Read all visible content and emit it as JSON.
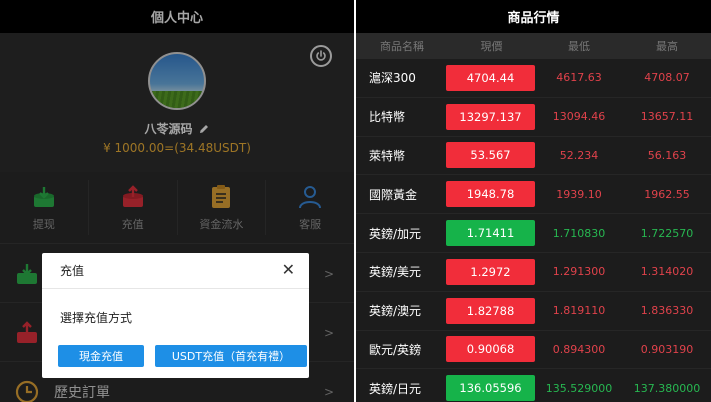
{
  "left": {
    "header_title": "個人中心",
    "username": "八苓源码",
    "balance": "¥ 1000.00=(34.48USDT)",
    "actions": [
      {
        "label": "提现",
        "icon": "download-box-icon",
        "color": "#2fb84f"
      },
      {
        "label": "充值",
        "icon": "upload-box-icon",
        "color": "#e8333f"
      },
      {
        "label": "資金流水",
        "icon": "clipboard-icon",
        "color": "#e8a93a"
      },
      {
        "label": "客服",
        "icon": "user-icon",
        "color": "#3b8ce0"
      }
    ],
    "list_rows": [
      {
        "label": "",
        "icon": "green-box-icon"
      },
      {
        "label": "",
        "icon": "red-box-icon"
      },
      {
        "label": "歷史訂單",
        "icon": "clock-icon"
      }
    ],
    "dialog": {
      "title": "充值",
      "prompt": "選擇充值方式",
      "btn_cash": "現金充值",
      "btn_usdt": "USDT充值（首充有禮）"
    }
  },
  "right": {
    "header_title": "商品行情",
    "columns": [
      "商品名稱",
      "現價",
      "最低",
      "最高"
    ],
    "rows": [
      {
        "name": "滬深300",
        "price": "4704.44",
        "low": "4617.63",
        "high": "4708.07",
        "trend": "red"
      },
      {
        "name": "比特幣",
        "price": "13297.137",
        "low": "13094.46",
        "high": "13657.11",
        "trend": "red"
      },
      {
        "name": "萊特幣",
        "price": "53.567",
        "low": "52.234",
        "high": "56.163",
        "trend": "red"
      },
      {
        "name": "國際黃金",
        "price": "1948.78",
        "low": "1939.10",
        "high": "1962.55",
        "trend": "red"
      },
      {
        "name": "英鎊/加元",
        "price": "1.71411",
        "low": "1.710830",
        "high": "1.722570",
        "trend": "green"
      },
      {
        "name": "英鎊/美元",
        "price": "1.2972",
        "low": "1.291300",
        "high": "1.314020",
        "trend": "red"
      },
      {
        "name": "英鎊/澳元",
        "price": "1.82788",
        "low": "1.819110",
        "high": "1.836330",
        "trend": "red"
      },
      {
        "name": "歐元/英鎊",
        "price": "0.90068",
        "low": "0.894300",
        "high": "0.903190",
        "trend": "red"
      },
      {
        "name": "英鎊/日元",
        "price": "136.05596",
        "low": "135.529000",
        "high": "137.380000",
        "trend": "green"
      }
    ]
  }
}
